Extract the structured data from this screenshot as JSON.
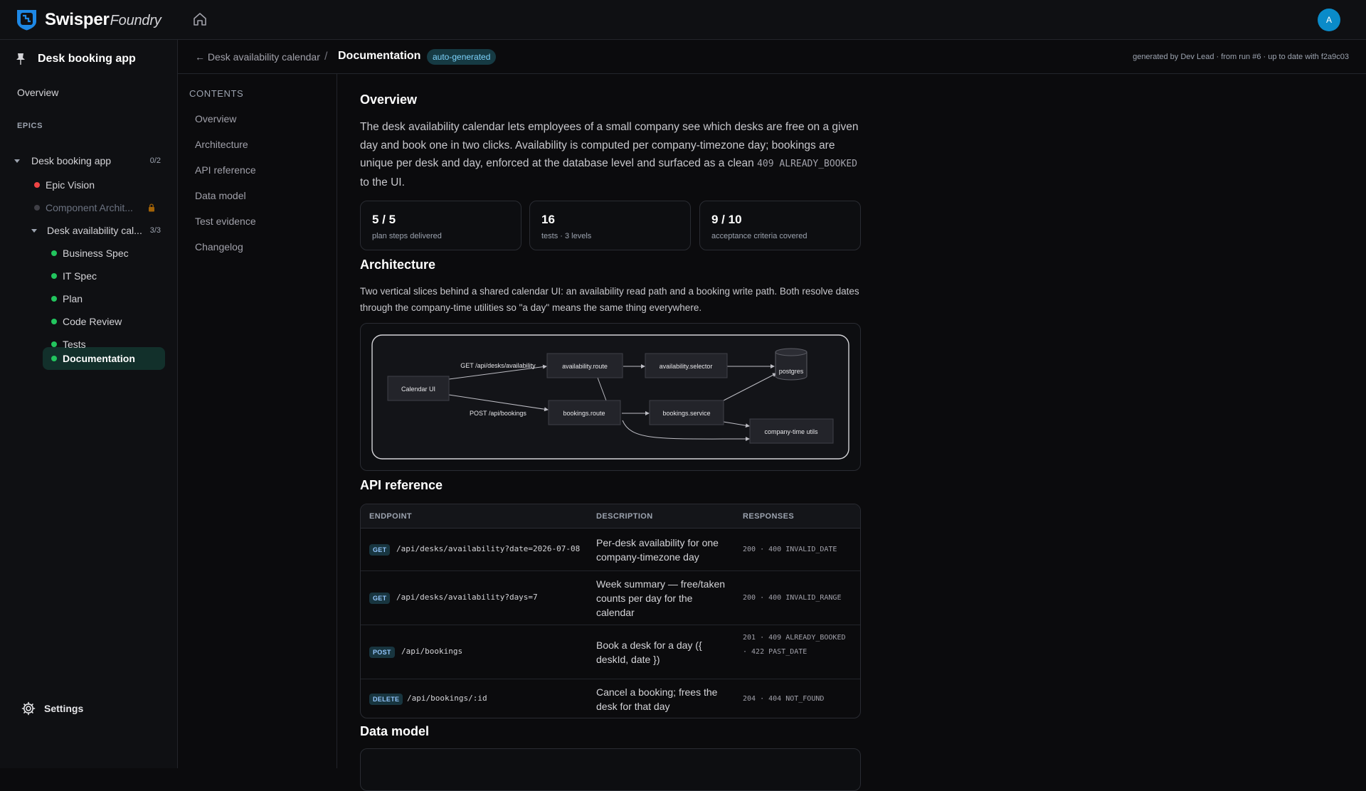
{
  "app": {
    "brand": "Swisper",
    "brand_sub": "Foundry",
    "avatar_initial": "A"
  },
  "sidebar": {
    "project_title": "Desk booking app",
    "overview": "Overview",
    "epics_label": "EPICS",
    "tree": [
      {
        "label": "Desk booking app",
        "count": "0/2"
      },
      {
        "label": "Epic Vision",
        "status_color": "#ef4444"
      },
      {
        "label": "Component Archit...",
        "status_color": "#4b5563"
      },
      {
        "label": "Desk availability cal...",
        "count": "3/3"
      },
      {
        "label": "Business Spec",
        "status_color": "#22c55e"
      },
      {
        "label": "IT Spec",
        "status_color": "#22c55e"
      },
      {
        "label": "Plan",
        "status_color": "#22c55e"
      },
      {
        "label": "Code Review",
        "status_color": "#22c55e"
      },
      {
        "label": "Tests",
        "status_color": "#22c55e"
      },
      {
        "label": "Documentation",
        "status_color": "#22c55e"
      }
    ],
    "settings": "Settings"
  },
  "breadcrumb": {
    "back": "← Desk availability calendar",
    "sep": "/",
    "current": "Documentation",
    "badge": "auto-generated",
    "meta": "generated by Dev Lead · from run #6 · up to date with f2a9c03"
  },
  "toc": {
    "title": "CONTENTS",
    "items": [
      "Overview",
      "Architecture",
      "API reference",
      "Data model",
      "Test evidence",
      "Changelog"
    ]
  },
  "overview": {
    "title": "Overview",
    "text": "The desk availability calendar lets employees of a small company see which desks are free on a given day and book one in two clicks. Availability is computed per company-timezone day; bookings are unique per desk and day, enforced at the database level and surfaced as a clean ",
    "code": "409 ALREADY_BOOKED",
    "text_end": " to the UI.",
    "stats": [
      {
        "value": "5 / 5",
        "label": "plan steps delivered"
      },
      {
        "value": "16",
        "label": "tests · 3 levels"
      },
      {
        "value": "9 / 10",
        "label": "acceptance criteria covered"
      }
    ]
  },
  "architecture": {
    "title": "Architecture",
    "text": "Two vertical slices behind a shared calendar UI: an availability read path and a booking write path. Both resolve dates through the company-time utilities so \"a day\" means the same thing everywhere.",
    "diagram": {
      "nodes": {
        "calendar_ui": "Calendar UI",
        "availability_route": "availability.route",
        "availability_selector": "availability.selector",
        "postgres": "postgres",
        "bookings_route": "bookings.route",
        "bookings_service": "bookings.service",
        "company_time": "company-time utils"
      },
      "edges": {
        "get_label": "GET /api/desks/availability",
        "post_label": "POST /api/bookings"
      }
    }
  },
  "api": {
    "title": "API reference",
    "headers": [
      "ENDPOINT",
      "DESCRIPTION",
      "RESPONSES"
    ],
    "rows": [
      {
        "method": "GET",
        "path": "/api/desks/availability?date=2026-07-08",
        "desc": "Per-desk availability for one company-timezone day",
        "resp": "200 · 400 INVALID_DATE"
      },
      {
        "method": "GET",
        "path": "/api/desks/availability?days=7",
        "desc": "Week summary — free/taken counts per day for the calendar",
        "resp": "200 · 400 INVALID_RANGE"
      },
      {
        "method": "POST",
        "path": "/api/bookings",
        "desc": "Book a desk for a day ({ deskId, date })",
        "resp": "201 · 409 ALREADY_BOOKED · 422 PAST_DATE"
      },
      {
        "method": "DELETE",
        "path": "/api/bookings/:id",
        "desc": "Cancel a booking; frees the desk for that day",
        "resp": "204 · 404 NOT_FOUND"
      }
    ]
  },
  "data_model": {
    "title": "Data model"
  }
}
